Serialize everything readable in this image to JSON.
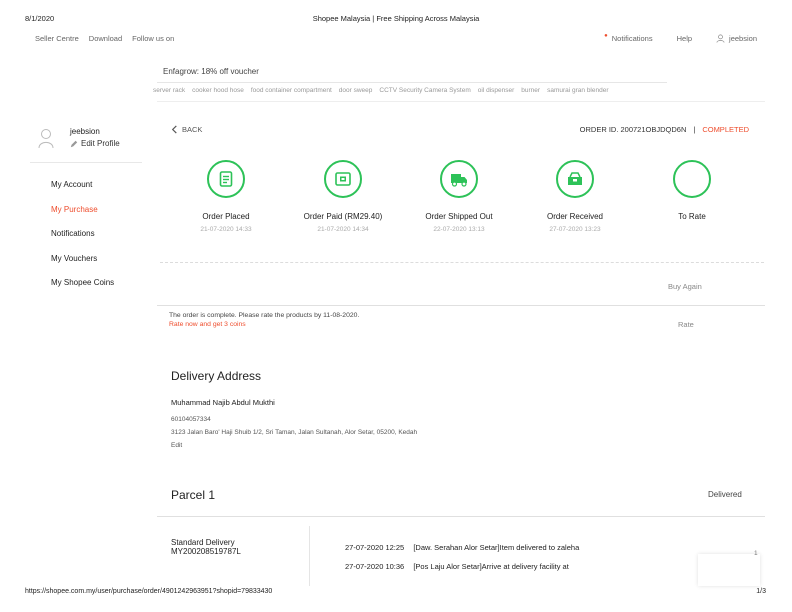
{
  "print_header": {
    "date": "8/1/2020",
    "title": "Shopee Malaysia | Free Shipping Across Malaysia"
  },
  "topnav": {
    "left_links": [
      "Seller Centre",
      "Download",
      "Follow us on"
    ],
    "notifications": "Notifications",
    "help": "Help",
    "username": "jeebsion"
  },
  "search": {
    "value": "Enfagrow: 18% off voucher"
  },
  "hints": [
    "server rack",
    "cooker hood hose",
    "food container compartment",
    "door sweep",
    "CCTV Security Camera System",
    "oil dispenser",
    "burner",
    "samurai gran blender"
  ],
  "sidebar": {
    "username": "jeebsion",
    "edit_profile": "Edit Profile",
    "menu": [
      {
        "label": "My Account",
        "active": false
      },
      {
        "label": "My Purchase",
        "active": true
      },
      {
        "label": "Notifications",
        "active": false
      },
      {
        "label": "My Vouchers",
        "active": false
      },
      {
        "label": "My Shopee Coins",
        "active": false
      }
    ]
  },
  "order": {
    "back_label": "BACK",
    "order_id_label": "ORDER ID. 200721OBJDQD6N",
    "separator": "|",
    "status": "COMPLETED",
    "steps": [
      {
        "label": "Order Placed",
        "time": "21-07-2020 14:33",
        "icon": "receipt-icon"
      },
      {
        "label": "Order Paid (RM29.40)",
        "time": "21-07-2020 14:34",
        "icon": "payment-icon"
      },
      {
        "label": "Order Shipped Out",
        "time": "22-07-2020 13:13",
        "icon": "truck-icon"
      },
      {
        "label": "Order Received",
        "time": "27-07-2020 13:23",
        "icon": "box-icon"
      },
      {
        "label": "To Rate",
        "time": "",
        "icon": "star-icon"
      }
    ],
    "buy_again": "Buy Again",
    "complete_message": "The order is complete. Please rate the products by 11-08-2020.",
    "rate_coins": "Rate now and get 3 coins",
    "rate_label": "Rate"
  },
  "delivery": {
    "title": "Delivery Address",
    "name": "Muhammad Najib Abdul Mukthi",
    "phone": "60104057334",
    "address": "3123 Jalan Baro' Haji Shuib 1/2, Sri Taman, Jalan Sultanah, Alor Setar, 05200, Kedah",
    "edit": "Edit"
  },
  "parcel": {
    "title": "Parcel 1",
    "status": "Delivered",
    "ship_type": "Standard Delivery",
    "tracking_no": "MY200208519787L",
    "events": [
      {
        "time": "27-07-2020 12:25",
        "desc": "[Daw. Serahan Alor Setar]Item delivered to zaleha"
      },
      {
        "time": "27-07-2020 10:36",
        "desc": "[Pos Laju Alor Setar]Arrive at delivery facility at"
      }
    ]
  },
  "chat_count": "1",
  "print_footer": {
    "url": "https://shopee.com.my/user/purchase/order/4901242963951?shopid=79833430",
    "page": "1/3"
  },
  "colors": {
    "accent": "#ee4d2d",
    "success": "#2dc258"
  }
}
